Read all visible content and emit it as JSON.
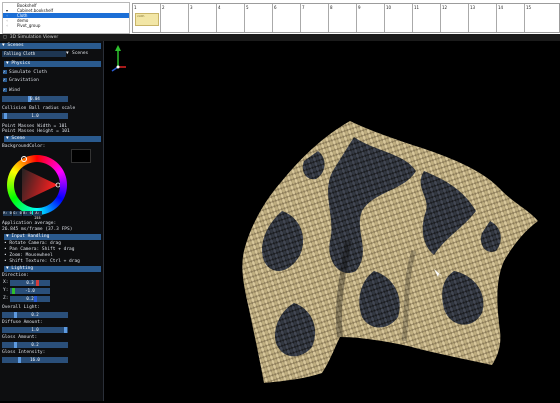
{
  "outline": {
    "header": "Bookshelf",
    "rows": [
      {
        "label": "Cabinet.bookshelf",
        "selected": false
      },
      {
        "label": "Cloth",
        "selected": true
      },
      {
        "label": "demo",
        "selected": false
      },
      {
        "label": "Pivot_group",
        "selected": false
      }
    ]
  },
  "timeline": {
    "frames": [
      "1",
      "2",
      "3",
      "4",
      "5",
      "6",
      "7",
      "8",
      "9",
      "10",
      "11",
      "12",
      "13",
      "14",
      "15"
    ],
    "thumbnail_label": "cloth"
  },
  "viewer": {
    "title": "3D Simulation Viewer"
  },
  "panel": {
    "scenes_header": "Scenes",
    "scene_select": "Falling Cloth",
    "scene_select_label": "Scenes",
    "physics_header": "Physics",
    "simulate_cloth": "Simulate Cloth",
    "gravitation": "Gravitation",
    "wind": "Wind",
    "wind_value": "0.04",
    "collision_label": "Collision Ball radius scale",
    "collision_value": "1.0",
    "point_width": "Point Masses Width = 101",
    "point_height": "Point Masses Height = 101",
    "scene_header": "Scene",
    "background_color": "BackgroundColor:",
    "rgb": [
      "R: 0",
      "G: 0",
      "B: 0",
      "A: 255"
    ],
    "app_average": "Application average:",
    "fps": "26.845 ms/frame (37.3 FPS)",
    "input_header": "Input Handling",
    "inputs": [
      "Rotate Camera: drag",
      "Pan Camera: Shift + drag",
      "Zoom: Mousewheel",
      "Shift Texture: Ctrl + drag"
    ],
    "lighting_header": "Lighting",
    "direction": "Direction:",
    "dir_x": "0.3",
    "dir_y": "-1.0",
    "dir_z": "0.2",
    "overall_light": "Overall Light:",
    "overall_value": "0.2",
    "diffuse": "Diffuse Amount:",
    "diffuse_value": "1.0",
    "gloss": "Gloss Amount:",
    "gloss_value": "0.2",
    "gloss_intensity": "Gloss Intensity:",
    "gloss_intensity_value": "16.0"
  },
  "colors": {
    "accent": "#2a5a8e",
    "selection": "#1c6fd6",
    "cloth_light": "#c8b48a",
    "cloth_dark": "#20232a"
  }
}
